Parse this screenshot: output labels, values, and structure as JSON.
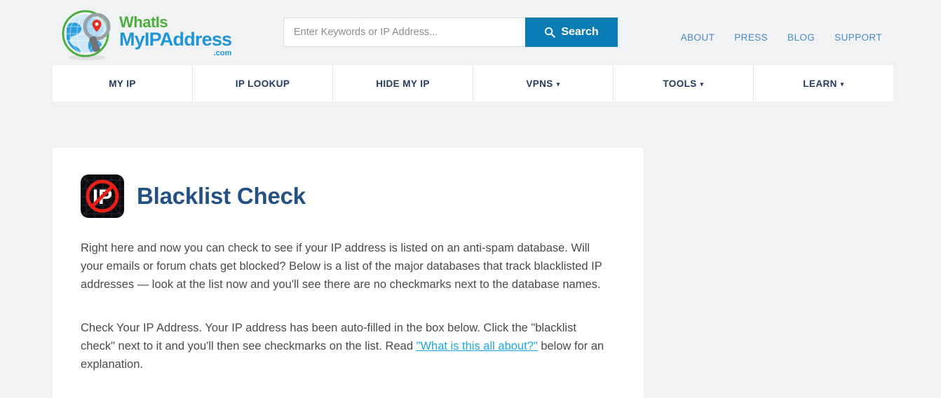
{
  "site": {
    "logo": {
      "line1": "WhatIs",
      "line2": "MyIPAddress",
      "line3": ".com",
      "icon": "globe-magnifier-logo",
      "color_green": "#4caf3d",
      "color_blue": "#2196d6"
    }
  },
  "search": {
    "placeholder": "Enter Keywords or IP Address...",
    "value": "",
    "button_label": "Search",
    "button_icon": "search-icon",
    "button_color": "#0c7cb5"
  },
  "top_links": [
    {
      "label": "ABOUT"
    },
    {
      "label": "PRESS"
    },
    {
      "label": "BLOG"
    },
    {
      "label": "SUPPORT"
    }
  ],
  "main_nav": [
    {
      "label": "MY IP",
      "caret": ""
    },
    {
      "label": "IP LOOKUP",
      "caret": ""
    },
    {
      "label": "HIDE MY IP",
      "caret": ""
    },
    {
      "label": "VPNS",
      "caret": "▾"
    },
    {
      "label": "TOOLS",
      "caret": "▾"
    },
    {
      "label": "LEARN",
      "caret": "▾"
    }
  ],
  "page": {
    "icon": "blacklist-no-ip-icon",
    "title": "Blacklist Check",
    "title_color": "#235181",
    "paragraph1": "Right here and now you can check to see if your IP address is listed on an anti-spam database. Will your emails or forum chats get blocked? Below is a list of the major databases that track blacklisted IP addresses — look at the list now and you'll see there are no checkmarks next to the database names.",
    "paragraph2_before": "Check Your IP Address. Your IP address has been auto-filled in the box below. Click the \"blacklist check\" next to it and you'll then see checkmarks on the list. Read ",
    "paragraph2_link": "\"What is this all about?\"",
    "paragraph2_after": " below for an explanation.",
    "link_color": "#1ea7dc"
  },
  "theme": {
    "page_background": "#f1f2f4",
    "card_background": "#ffffff",
    "nav_text": "#243a5e",
    "top_link_color": "#4a89c8"
  }
}
